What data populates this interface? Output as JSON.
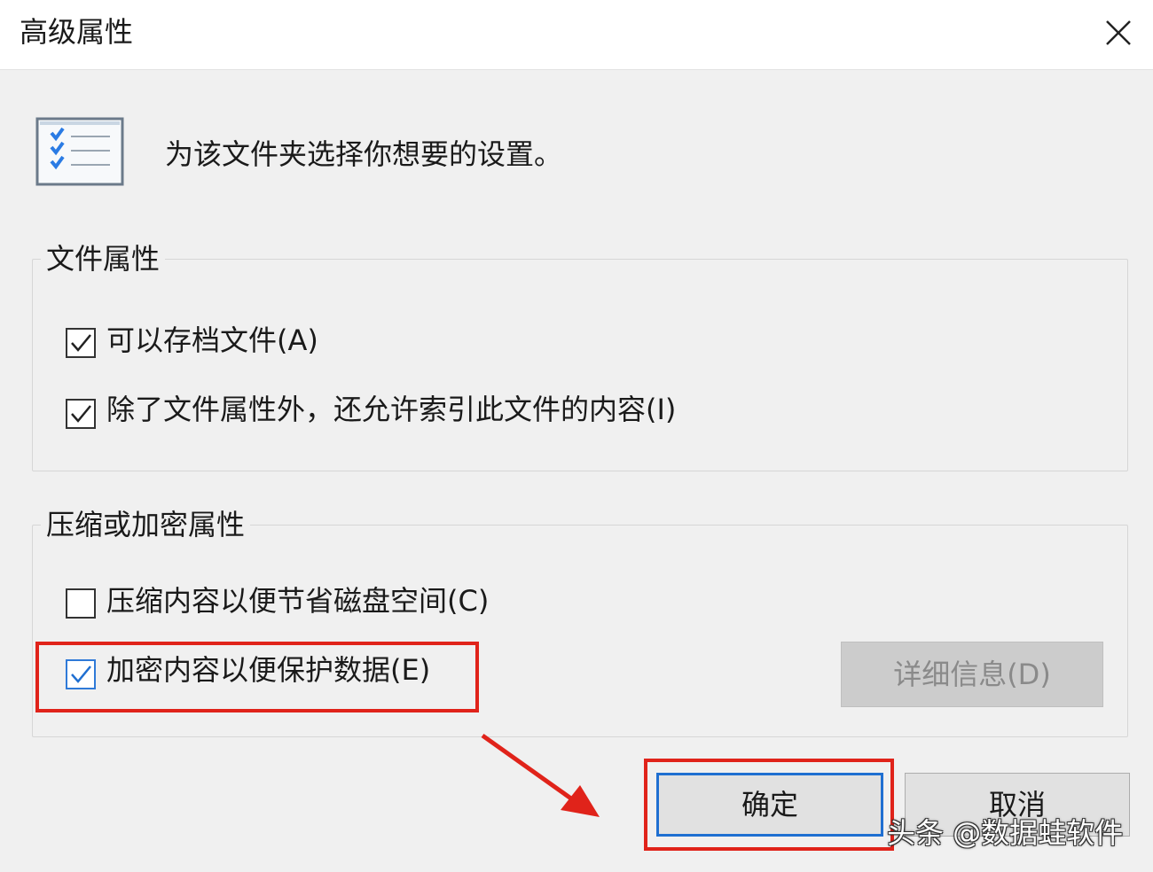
{
  "window": {
    "title": "高级属性",
    "close_icon": "close-icon"
  },
  "intro": {
    "icon": "settings-checklist-icon",
    "text": "为该文件夹选择你想要的设置。"
  },
  "file_attributes": {
    "title": "文件属性",
    "archive": {
      "label": "可以存档文件(A)",
      "checked": true
    },
    "index": {
      "label": "除了文件属性外，还允许索引此文件的内容(I)",
      "checked": true
    }
  },
  "compress_encrypt": {
    "title": "压缩或加密属性",
    "compress": {
      "label": "压缩内容以便节省磁盘空间(C)",
      "checked": false
    },
    "encrypt": {
      "label": "加密内容以便保护数据(E)",
      "checked": true
    },
    "details_button": "详细信息(D)"
  },
  "buttons": {
    "ok": "确定",
    "cancel": "取消"
  },
  "annotations": {
    "highlight_color": "#e0231a",
    "arrow_color": "#e0231a"
  },
  "watermark": "头条 @数据蛙软件"
}
